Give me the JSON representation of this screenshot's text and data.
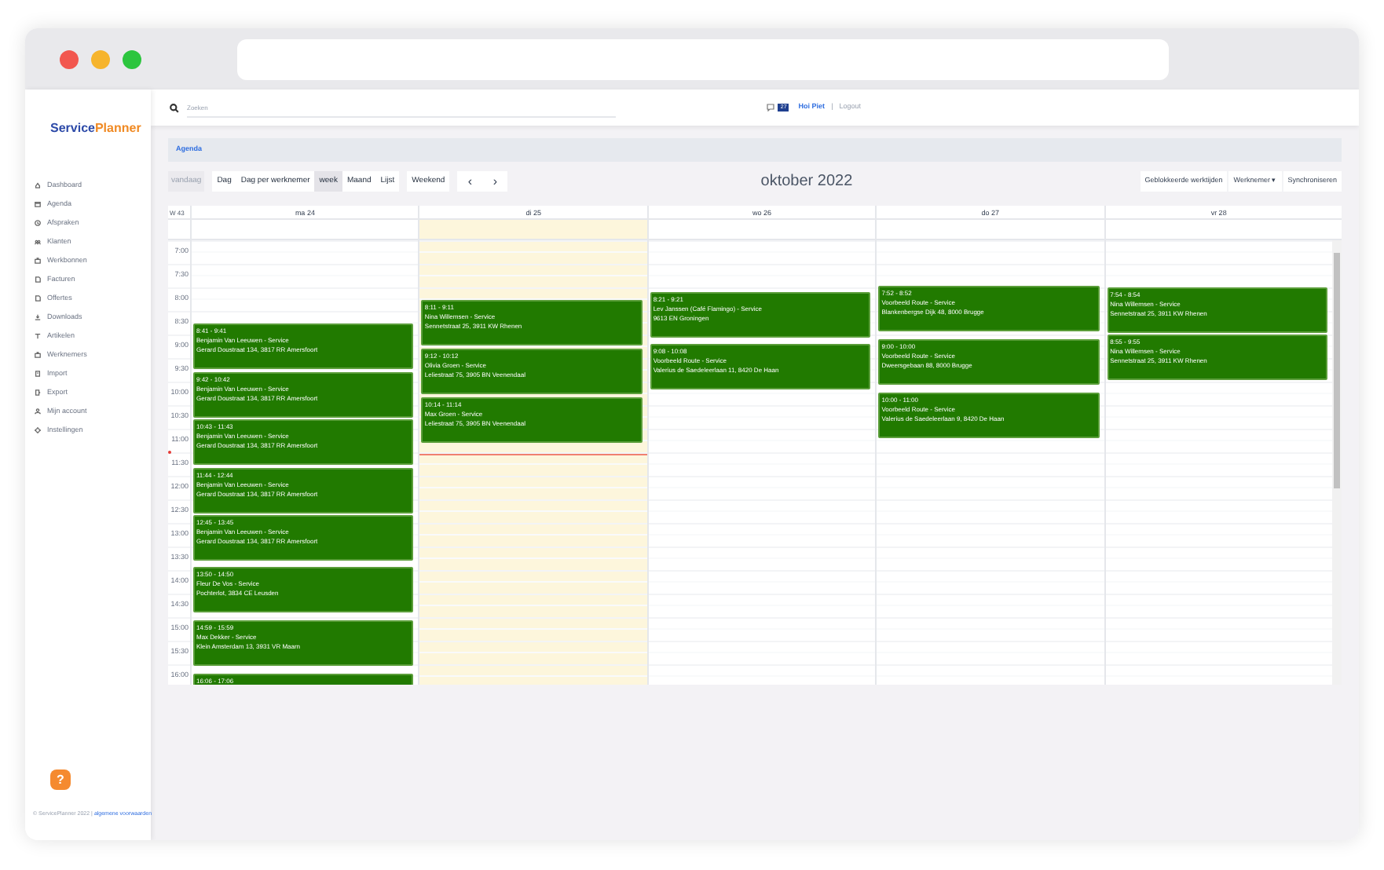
{
  "sidebar": {
    "logo": {
      "part_1": "Service",
      "part_2": "Planner"
    },
    "items": [
      {
        "label": "Dashboard"
      },
      {
        "label": "Agenda"
      },
      {
        "label": "Afspraken"
      },
      {
        "label": "Klanten"
      },
      {
        "label": "Werkbonnen"
      },
      {
        "label": "Facturen"
      },
      {
        "label": "Offertes"
      },
      {
        "label": "Downloads"
      },
      {
        "label": "Artikelen"
      },
      {
        "label": "Werknemers"
      },
      {
        "label": "Import"
      },
      {
        "label": "Export"
      },
      {
        "label": "Mijn account"
      },
      {
        "label": "Instellingen"
      }
    ],
    "help": "?",
    "footer": {
      "copyright": "© ServicePlanner 2022 |",
      "link": "algemene voorwaarden"
    }
  },
  "header": {
    "search": {
      "placeholder": "Zoeken"
    },
    "badge": "27",
    "greeting": "Hoi Piet",
    "separator": "|",
    "logout": "Logout"
  },
  "breadcrumb": "Agenda",
  "toolbar": {
    "today": {
      "label": "vandaag",
      "disabled": true
    },
    "views": [
      {
        "label": "Dag",
        "selected": false
      },
      {
        "label": "Dag per werknemer",
        "selected": false
      },
      {
        "label": "week",
        "selected": true
      },
      {
        "label": "Maand",
        "selected": false
      },
      {
        "label": "Lijst",
        "selected": false
      }
    ],
    "weekend": "Weekend",
    "prev": "‹",
    "next": "›",
    "title": "oktober 2022",
    "actions": [
      "Geblokkeerde werktijden",
      "Werknemer ▾",
      "Synchroniseren"
    ]
  },
  "calendar": {
    "week_label": "W 43",
    "times": [
      "7:00",
      "7:30",
      "8:00",
      "8:30",
      "9:00",
      "9:30",
      "10:00",
      "10:30",
      "11:00",
      "11:30",
      "12:00",
      "12:30",
      "13:00",
      "13:30",
      "14:00",
      "14:30",
      "15:00",
      "15:30",
      "16:00"
    ],
    "days": [
      {
        "label": "ma 24",
        "today": false,
        "events": [
          {
            "time": "8:41 - 9:41",
            "title": "Benjamin Van Leeuwen - Service",
            "address": "Gerard Doustraat 134, 3817 RR Amersfoort"
          },
          {
            "time": "9:42 - 10:42",
            "title": "Benjamin Van Leeuwen - Service",
            "address": "Gerard Doustraat 134, 3817 RR Amersfoort"
          },
          {
            "time": "10:43 - 11:43",
            "title": "Benjamin Van Leeuwen - Service",
            "address": "Gerard Doustraat 134, 3817 RR Amersfoort"
          },
          {
            "time": "11:44 - 12:44",
            "title": "Benjamin Van Leeuwen - Service",
            "address": "Gerard Doustraat 134, 3817 RR Amersfoort"
          },
          {
            "time": "12:45 - 13:45",
            "title": "Benjamin Van Leeuwen - Service",
            "address": "Gerard Doustraat 134, 3817 RR Amersfoort"
          },
          {
            "time": "13:50 - 14:50",
            "title": "Fleur De Vos - Service",
            "address": "Pochterlot, 3834 CE Leusden"
          },
          {
            "time": "14:59 - 15:59",
            "title": "Max Dekker - Service",
            "address": "Klein Amsterdam 13, 3931 VR Maarn"
          },
          {
            "time": "16:06 - 17:06"
          }
        ]
      },
      {
        "label": "di 25",
        "today": true,
        "events": [
          {
            "time": "8:11 - 9:11",
            "title": "Nina Willemsen - Service",
            "address": "Sennetstraat 25, 3911 KW Rhenen"
          },
          {
            "time": "9:12 - 10:12",
            "title": "Olivia Groen - Service",
            "address": "Leliestraat 75, 3905 BN Veenendaal"
          },
          {
            "time": "10:14 - 11:14",
            "title": "Max Groen - Service",
            "address": "Leliestraat 75, 3905 BN Veenendaal"
          }
        ]
      },
      {
        "label": "wo 26",
        "today": false,
        "events": [
          {
            "time": "8:21 - 9:21",
            "title": "Lev Janssen (Café Flamingo) - Service",
            "address": "9613 EN Groningen"
          },
          {
            "time": "9:08 - 10:08",
            "title": "Voorbeeld Route - Service",
            "address": "Valerius de Saedeleerlaan 11, 8420 De Haan"
          }
        ]
      },
      {
        "label": "do 27",
        "today": false,
        "events": [
          {
            "time": "7:52 - 8:52",
            "title": "Voorbeeld Route - Service",
            "address": "Blankenbergse Dijk 48, 8000 Brugge"
          },
          {
            "time": "9:00 - 10:00",
            "title": "Voorbeeld Route - Service",
            "address": "Dweersgebaan 88, 8000 Brugge"
          },
          {
            "time": "10:00 - 11:00",
            "title": "Voorbeeld Route - Service",
            "address": "Valerius de Saedeleerlaan 9, 8420 De Haan"
          }
        ]
      },
      {
        "label": "vr 28",
        "today": false,
        "events": [
          {
            "time": "7:54 - 8:54",
            "title": "Nina Willemsen - Service",
            "address": "Sennetstraat 25, 3911 KW Rhenen"
          },
          {
            "time": "8:55 - 9:55",
            "title": "Nina Willemsen - Service",
            "address": "Sennetstraat 25, 3911 KW Rhenen"
          }
        ]
      }
    ]
  }
}
